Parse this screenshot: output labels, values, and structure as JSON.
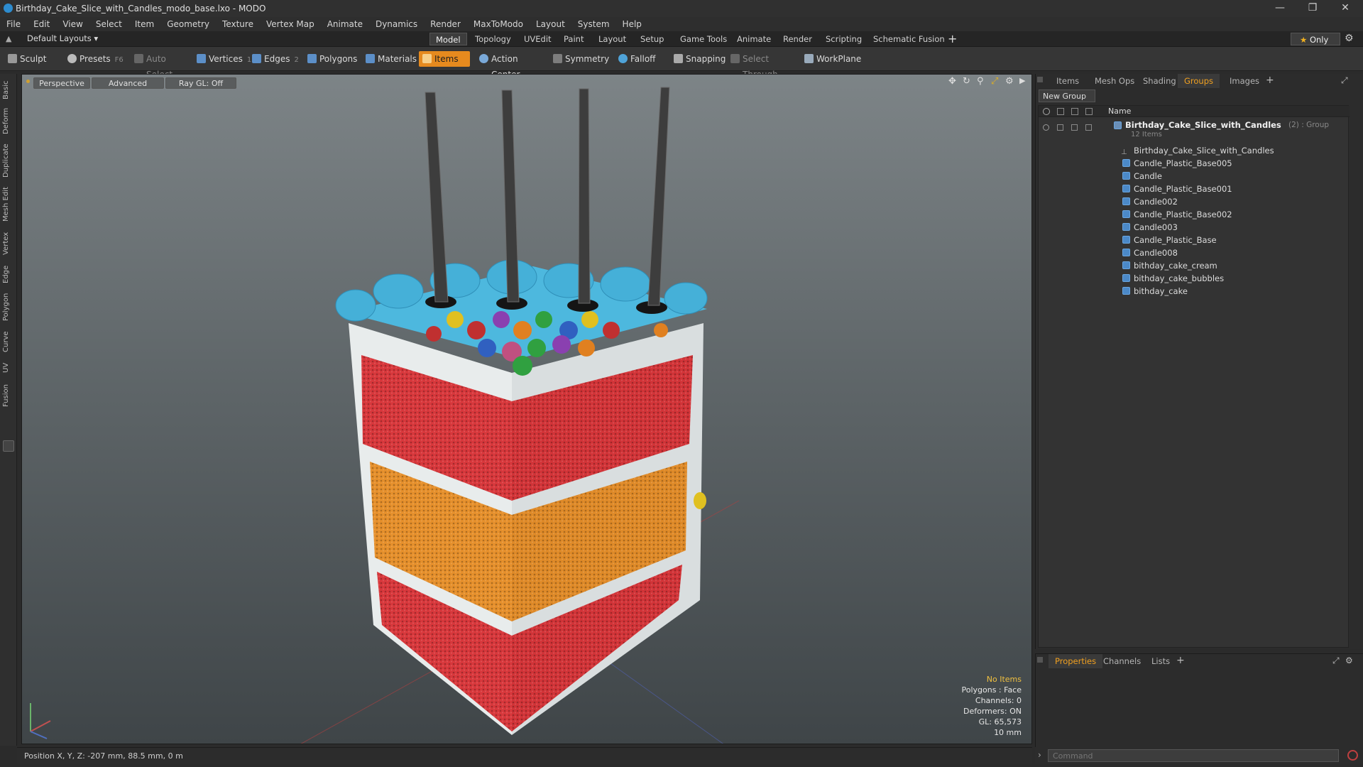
{
  "window": {
    "title": "Birthday_Cake_Slice_with_Candles_modo_base.lxo - MODO"
  },
  "menu": [
    "File",
    "Edit",
    "View",
    "Select",
    "Item",
    "Geometry",
    "Texture",
    "Vertex Map",
    "Animate",
    "Dynamics",
    "Render",
    "MaxToModo",
    "Layout",
    "System",
    "Help"
  ],
  "layout": {
    "preset": "Default Layouts ▾",
    "tabs": [
      "Model",
      "Topology",
      "UVEdit",
      "Paint",
      "Layout",
      "Setup",
      "Game Tools",
      "Animate",
      "Render",
      "Scripting",
      "Schematic Fusion"
    ],
    "active_tab": "Model",
    "only_label": "Only"
  },
  "toolbar": {
    "sculpt": "Sculpt",
    "presets": "Presets",
    "presets_key": "F6",
    "auto_select": "Auto Select",
    "vertices": "Vertices",
    "vertices_num": "1",
    "edges": "Edges",
    "edges_num": "2",
    "polygons": "Polygons",
    "materials": "Materials",
    "items": "Items",
    "action_center": "Action Center",
    "symmetry": "Symmetry",
    "falloff": "Falloff",
    "snapping": "Snapping",
    "select_through": "Select Through",
    "workplane": "WorkPlane"
  },
  "left_tabs": [
    "Basic",
    "Deform",
    "Duplicate",
    "Mesh Edit",
    "Vertex",
    "Edge",
    "Polygon",
    "Curve",
    "UV",
    "Fusion"
  ],
  "viewport": {
    "perspective": "Perspective",
    "advanced": "Advanced",
    "raygl": "Ray GL: Off",
    "info": {
      "no_items": "No Items",
      "polygons": "Polygons : Face",
      "channels": "Channels: 0",
      "deformers": "Deformers: ON",
      "gl": "GL: 65,573",
      "scale": "10 mm"
    }
  },
  "status": {
    "position": "Position X, Y, Z:  -207 mm, 88.5 mm, 0 m"
  },
  "right_panel": {
    "tabs": [
      "Items",
      "Mesh Ops",
      "Shading",
      "Groups",
      "Images"
    ],
    "active_tab": "Groups",
    "new_group": "New Group",
    "name_header": "Name",
    "group": {
      "name": "Birthday_Cake_Slice_with_Candles",
      "suffix": "(2) : Group",
      "count": "12 Items"
    },
    "items": [
      "Birthday_Cake_Slice_with_Candles",
      "Candle_Plastic_Base005",
      "Candle",
      "Candle_Plastic_Base001",
      "Candle002",
      "Candle_Plastic_Base002",
      "Candle003",
      "Candle_Plastic_Base",
      "Candle008",
      "bithday_cake_cream",
      "bithday_cake_bubbles",
      "bithday_cake"
    ]
  },
  "bottom_panel": {
    "tabs": [
      "Properties",
      "Channels",
      "Lists"
    ],
    "active_tab": "Properties"
  },
  "command": {
    "placeholder": "Command"
  }
}
